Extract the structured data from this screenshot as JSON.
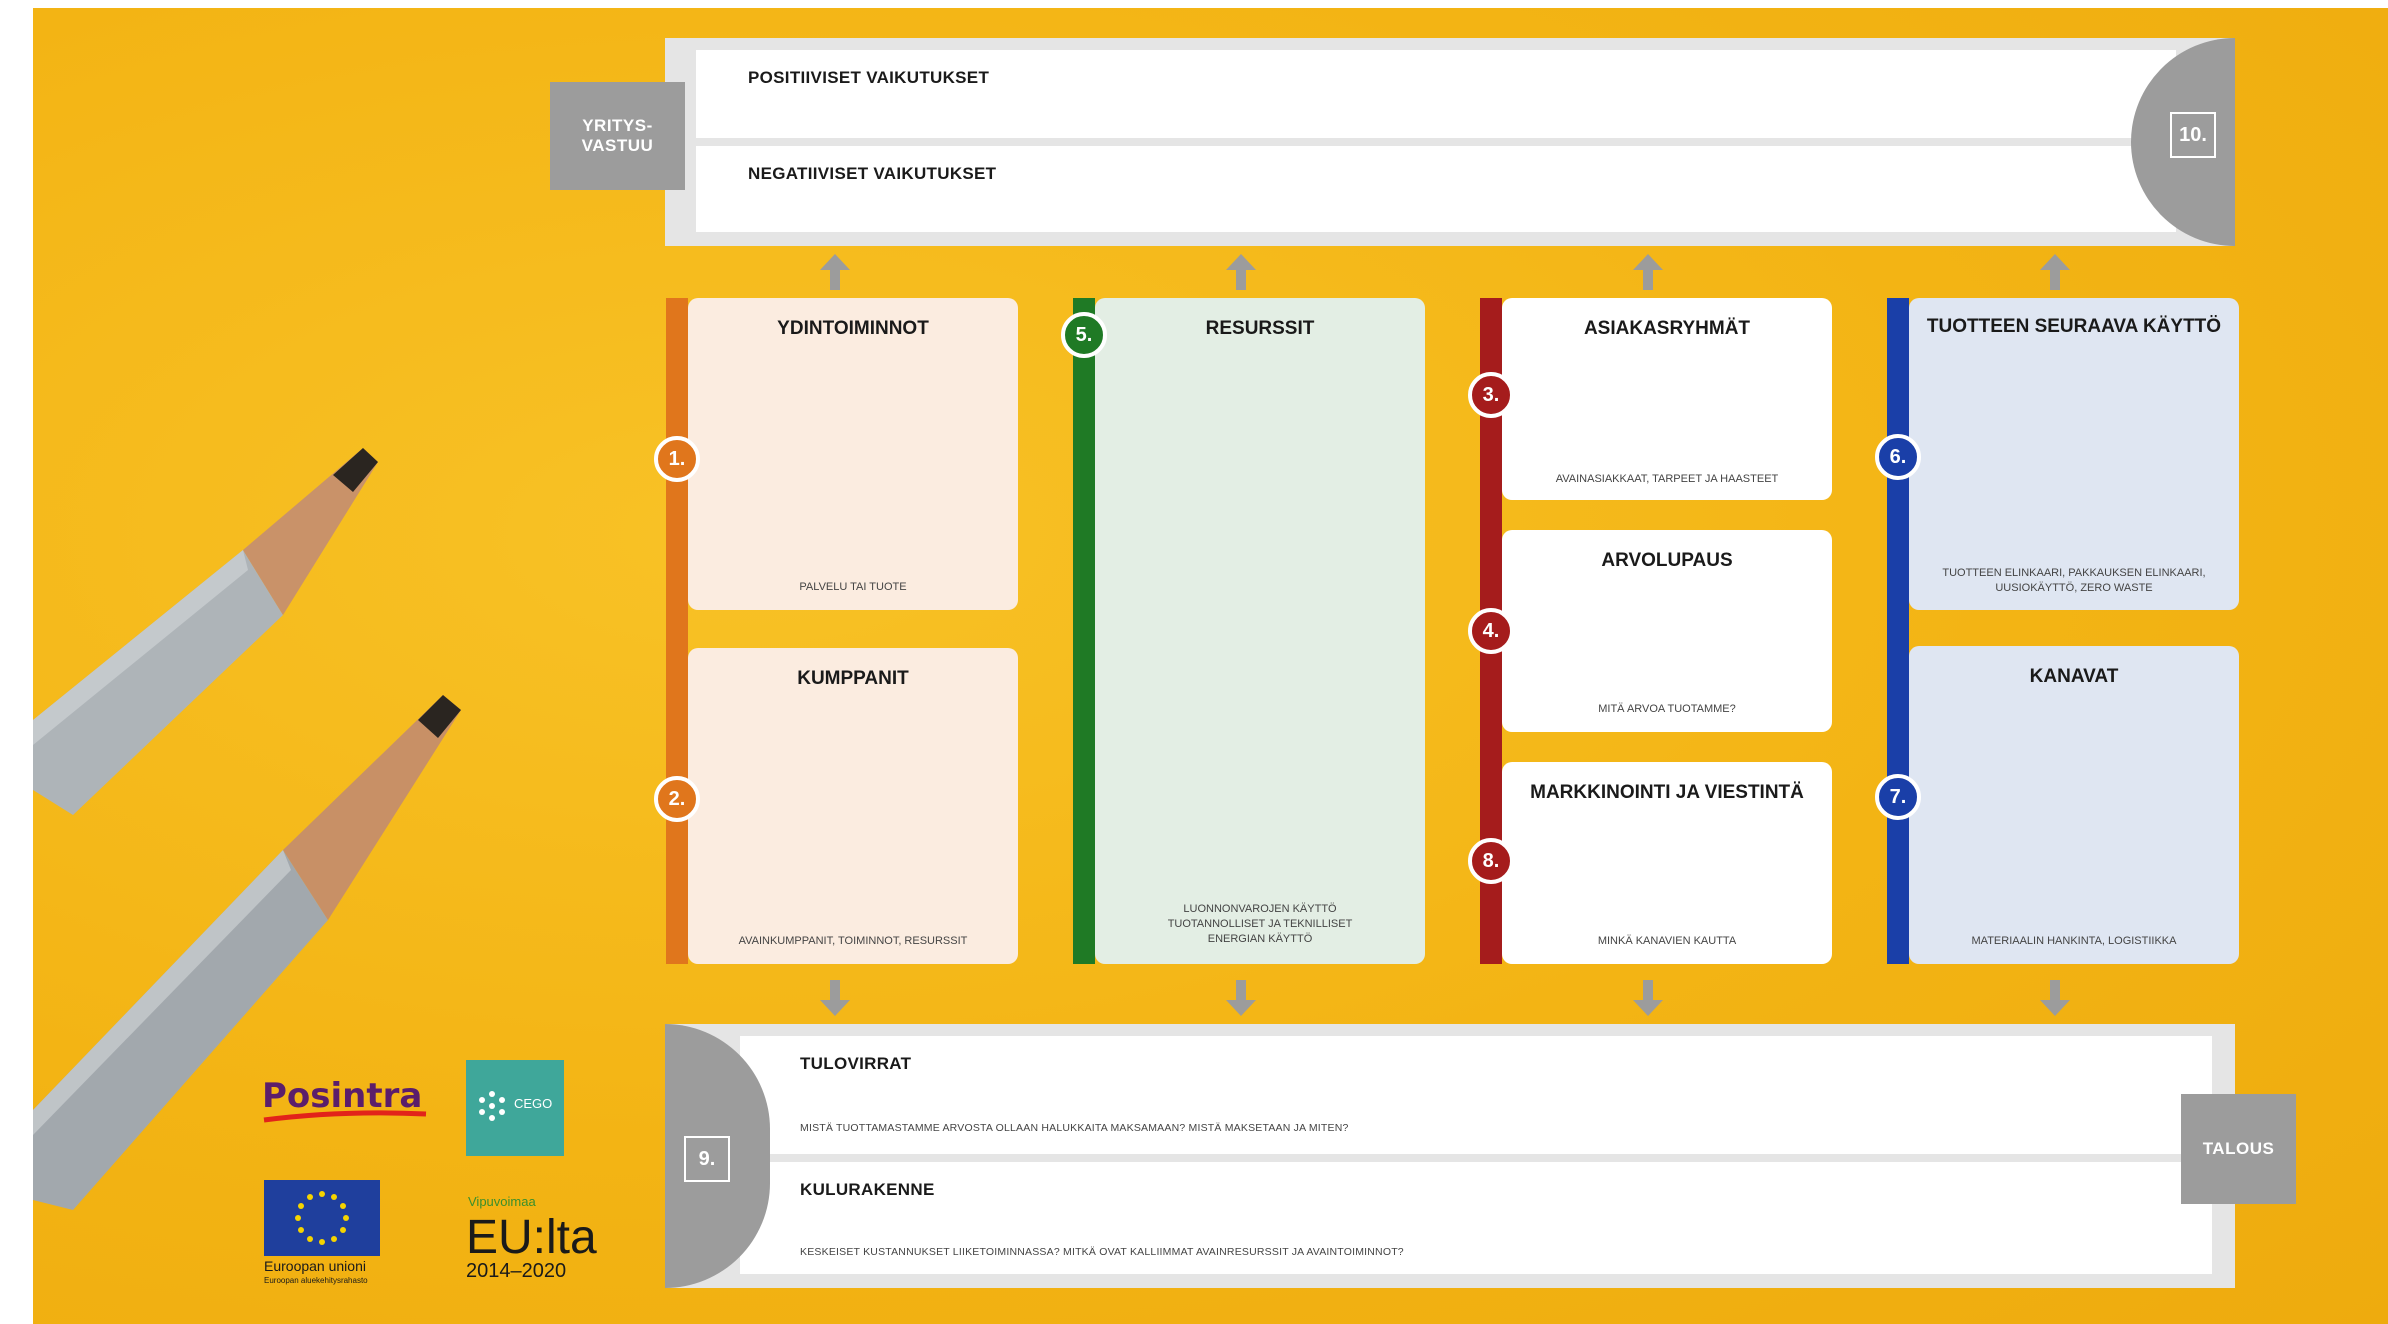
{
  "colors": {
    "background": "#f5b818",
    "orange": "#e0761c",
    "green": "#1f7a25",
    "red": "#a51c1c",
    "blue": "#1a3fa8",
    "gray": "#9c9c9c"
  },
  "top_section": {
    "label": "YRITYS-\nVASTUU",
    "number": "10.",
    "positive": "POSITIIVISET VAIKUTUKSET",
    "negative": "NEGATIIVISET VAIKUTUKSET"
  },
  "cards": {
    "ydintoiminnot": {
      "number": "1.",
      "title": "YDINTOIMINNOT",
      "subtitle": "PALVELU TAI TUOTE"
    },
    "kumppanit": {
      "number": "2.",
      "title": "KUMPPANIT",
      "subtitle": "AVAINKUMPPANIT, TOIMINNOT, RESURSSIT"
    },
    "resurssit": {
      "number": "5.",
      "title": "RESURSSIT",
      "subtitle": "LUONNONVAROJEN KÄYTTÖ\nTUOTANNOLLISET JA TEKNILLISET\nENERGIAN KÄYTTÖ"
    },
    "asiakasryhmat": {
      "number": "3.",
      "title": "ASIAKASRYHMÄT",
      "subtitle": "AVAINASIAKKAAT, TARPEET JA HAASTEET"
    },
    "arvolupaus": {
      "number": "4.",
      "title": "ARVOLUPAUS",
      "subtitle": "MITÄ ARVOA TUOTAMME?"
    },
    "markkinointi": {
      "number": "8.",
      "title": "MARKKINOINTI JA VIESTINTÄ",
      "subtitle": "MINKÄ KANAVIEN KAUTTA"
    },
    "seuraava_kaytto": {
      "number": "6.",
      "title": "TUOTTEEN SEURAAVA KÄYTTÖ",
      "subtitle": "TUOTTEEN ELINKAARI, PAKKAUKSEN ELINKAARI,\nUUSIOKÄYTTÖ, ZERO WASTE"
    },
    "kanavat": {
      "number": "7.",
      "title": "KANAVAT",
      "subtitle": "MATERIAALIN HANKINTA, LOGISTIIKKA"
    }
  },
  "bottom_section": {
    "label": "TALOUS",
    "number": "9.",
    "revenue_title": "TULOVIRRAT",
    "revenue_sub": "MISTÄ TUOTTAMASTAMME ARVOSTA OLLAAN HALUKKAITA MAKSAMAAN? MISTÄ MAKSETAAN JA MITEN?",
    "cost_title": "KULURAKENNE",
    "cost_sub": "KESKEISET KUSTANNUKSET LIIKETOIMINNASSA? MITKÄ OVAT KALLIIMMAT AVAINRESURSSIT JA AVAINTOIMINNOT?"
  },
  "logos": {
    "posintra": "Posintra",
    "cego": "CEGO",
    "eu_name": "Euroopan unioni",
    "eu_fund": "Euroopan aluekehitysrahasto",
    "vipuvoimaa": "Vipuvoimaa",
    "eulta": "EU:lta",
    "years": "2014–2020"
  }
}
